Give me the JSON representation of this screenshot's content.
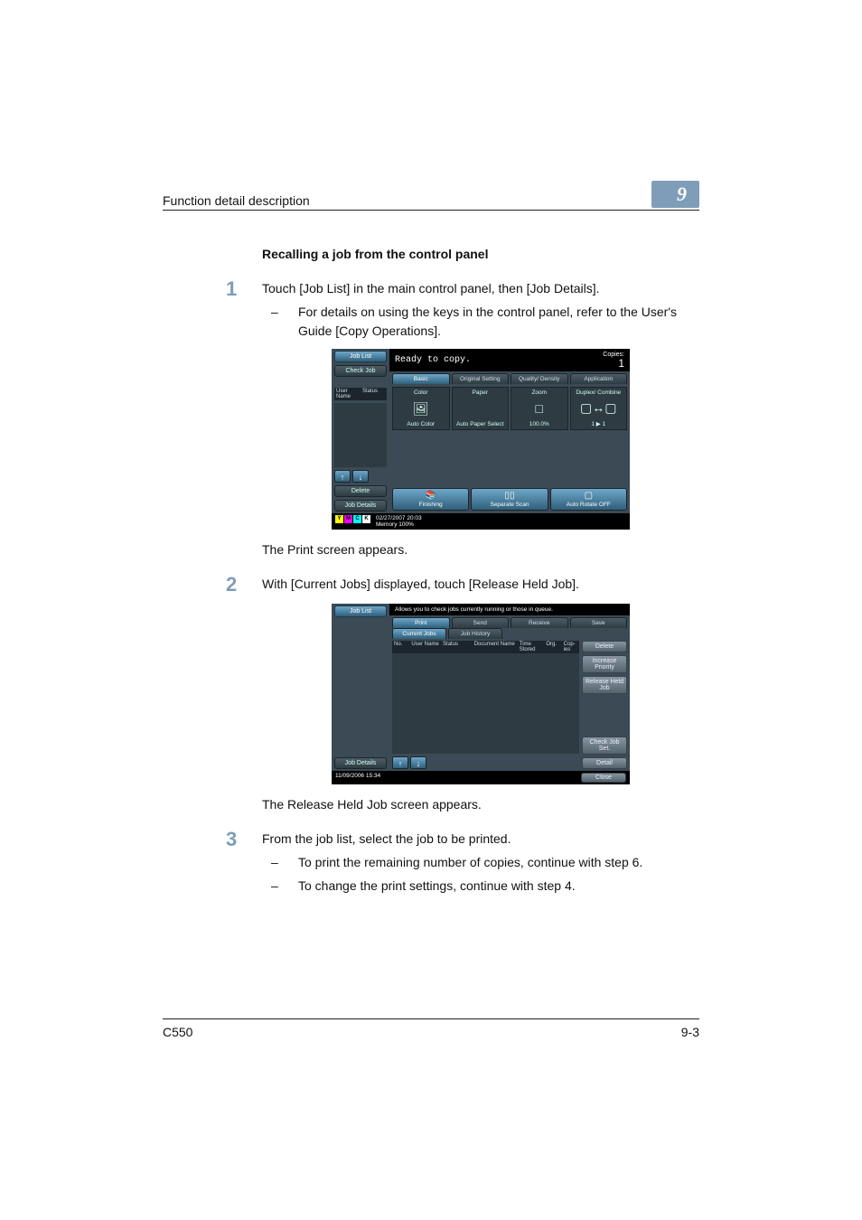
{
  "header": {
    "left": "Function detail description",
    "chapter": "9"
  },
  "section_title": "Recalling a job from the control panel",
  "step1": {
    "num": "1",
    "text": "Touch [Job List] in the main control panel, then [Job Details].",
    "bullet": "For details on using the keys in the control panel, refer to the User's Guide [Copy Operations]."
  },
  "screen1": {
    "sidebar": {
      "job_list": "Job List",
      "check_job": "Check Job",
      "col1": "User Name",
      "col2": "Status",
      "delete": "Delete",
      "job_details": "Job Details"
    },
    "title": "Ready to copy.",
    "copies_label": "Copies:",
    "copies_value": "1",
    "tabs": {
      "basic": "Basic",
      "orig": "Original Setting",
      "qual": "Quality/ Density",
      "app": "Application"
    },
    "tiles": {
      "color_h": "Color",
      "color_v": "Auto Color",
      "paper_h": "Paper",
      "paper_v": "Auto Paper Select",
      "zoom_h": "Zoom",
      "zoom_v": "100.0%",
      "dup_h": "Duplex/ Combine",
      "dup_v": "1 ▶ 1"
    },
    "bottom": {
      "fin": "Finishing",
      "sep": "Separate Scan",
      "rot": "Auto Rotate OFF"
    },
    "footer": {
      "date": "02/27/2007   20:03",
      "mem": "Memory      100%"
    }
  },
  "after1": "The Print screen appears.",
  "step2": {
    "num": "2",
    "text": "With [Current Jobs] displayed, touch [Release Held Job]."
  },
  "screen2": {
    "job_list": "Job List",
    "job_details": "Job Details",
    "title": "Allows you to check jobs currently running or those in queue.",
    "tabs": {
      "print": "Print",
      "send": "Send",
      "recv": "Receive",
      "save": "Save"
    },
    "sub": {
      "cur": "Current Jobs",
      "hist": "Job History"
    },
    "cols": {
      "no": "No.",
      "user": "User Name",
      "status": "Status",
      "doc": "Document Name",
      "time": "Time Stored",
      "org": "Org.",
      "cop": "Cop- ies"
    },
    "right": {
      "delete": "Delete",
      "incr": "Increase Priority",
      "rel": "Release Held Job",
      "chk": "Check Job Set.",
      "det": "Detail",
      "close": "Close"
    },
    "footer": "11/09/2006    15:34"
  },
  "after2": "The Release Held Job screen appears.",
  "step3": {
    "num": "3",
    "text": "From the job list, select the job to be printed.",
    "b1": "To print the remaining number of copies, continue with step 6.",
    "b2": "To change the print settings, continue with step 4."
  },
  "footer": {
    "model": "C550",
    "page": "9-3"
  }
}
